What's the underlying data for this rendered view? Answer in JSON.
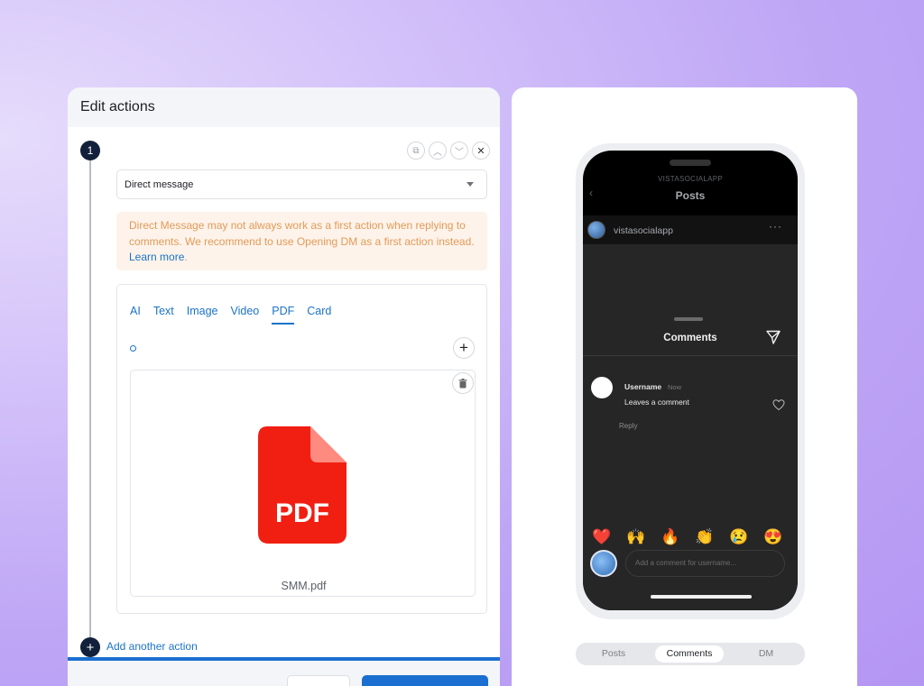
{
  "editor": {
    "title": "Edit actions",
    "step_number": "1",
    "action_type": "Direct message",
    "warning_text": "Direct Message may not always work as a first action when replying to comments. We recommend to use Opening DM as a first action instead. ",
    "warning_link": "Learn more",
    "warning_end": ".",
    "tabs": [
      "AI",
      "Text",
      "Image",
      "Video",
      "PDF",
      "Card"
    ],
    "active_tab": "PDF",
    "pdf_label": "PDF",
    "file_name": "SMM.pdf",
    "add_action_label": "Add another action"
  },
  "preview": {
    "account_name": "VISTASOCIALAPP",
    "screen_title": "Posts",
    "post_username": "vistasocialapp",
    "sheet_title": "Comments",
    "comment": {
      "username": "Username",
      "time": "Now",
      "text": "Leaves a comment",
      "reply_label": "Reply"
    },
    "emojis": [
      "❤️",
      "🙌",
      "🔥",
      "👏",
      "😢",
      "😍",
      "😮"
    ],
    "input_placeholder": "Add a comment for username...",
    "segments": [
      "Posts",
      "Comments",
      "DM"
    ],
    "active_segment": "Comments"
  },
  "colors": {
    "accent": "#1b73c8",
    "step_badge": "#12203b",
    "warning_text": "#e39a58",
    "warning_bg": "#fdf3ea",
    "pdf_red": "#f01f12"
  }
}
